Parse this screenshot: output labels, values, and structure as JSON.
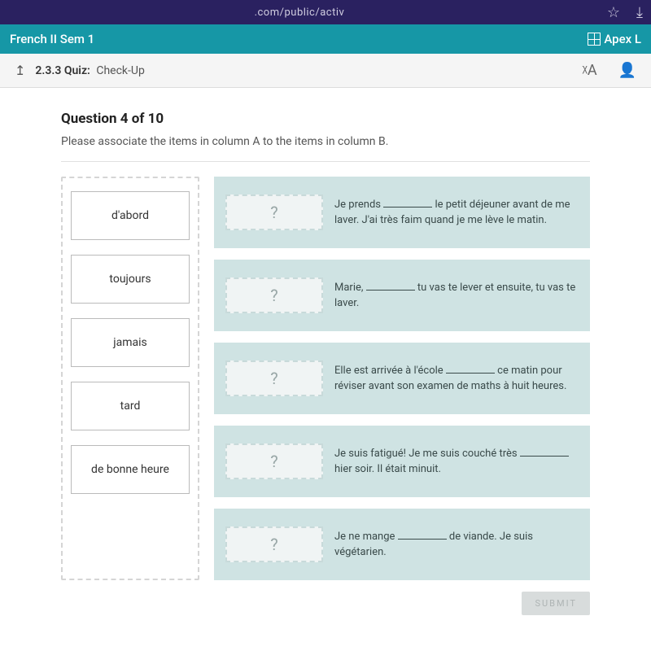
{
  "browser": {
    "url_fragment": ".com/public/activ",
    "star_icon": "☆",
    "download_icon": "⤓"
  },
  "course": {
    "title": "French II Sem 1",
    "apex_label": "Apex L"
  },
  "quiz_bar": {
    "back_glyph": "↥",
    "number": "2.3.3",
    "label_prefix": "Quiz:",
    "label": "Check-Up",
    "translate_glyph": "ᵡA",
    "reader_glyph": "👤"
  },
  "question": {
    "header": "Question 4 of 10",
    "prompt": "Please associate the items in column A to the items in column B."
  },
  "column_a": [
    "d'abord",
    "toujours",
    "jamais",
    "tard",
    "de bonne heure"
  ],
  "targets": [
    {
      "drop_placeholder": "?",
      "text_before": "Je prends ",
      "text_after": " le petit déjeuner avant de me laver. J'ai très faim quand je me lève le matin."
    },
    {
      "drop_placeholder": "?",
      "text_before": "Marie, ",
      "text_after": " tu vas te lever et ensuite, tu vas te laver."
    },
    {
      "drop_placeholder": "?",
      "text_before": "Elle est arrivée à l'école ",
      "text_after": " ce matin pour réviser avant son examen de maths à huit heures."
    },
    {
      "drop_placeholder": "?",
      "text_before": "Je suis fatigué! Je me suis couché très ",
      "text_after": " hier soir. Il était minuit."
    },
    {
      "drop_placeholder": "?",
      "text_before": "Je ne mange ",
      "text_after": " de viande. Je suis végétarien."
    }
  ],
  "submit_label": "SUBMIT"
}
